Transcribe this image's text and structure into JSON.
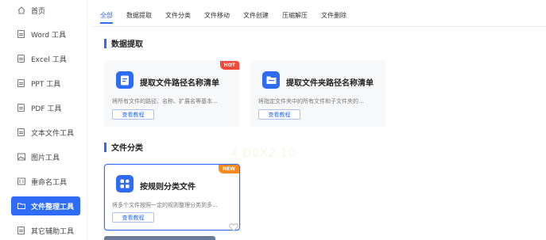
{
  "sidebar": {
    "items": [
      {
        "label": "首页",
        "icon": "home-icon"
      },
      {
        "label": "Word 工具",
        "icon": "document-icon"
      },
      {
        "label": "Excel 工具",
        "icon": "document-icon"
      },
      {
        "label": "PPT 工具",
        "icon": "document-icon"
      },
      {
        "label": "PDF 工具",
        "icon": "document-icon"
      },
      {
        "label": "文本文件工具",
        "icon": "document-icon"
      },
      {
        "label": "图片工具",
        "icon": "image-icon"
      },
      {
        "label": "重命名工具",
        "icon": "rename-icon"
      },
      {
        "label": "文件整理工具",
        "icon": "folder-icon"
      },
      {
        "label": "其它辅助工具",
        "icon": "tools-icon"
      }
    ],
    "active_index": 8
  },
  "tabs": [
    "全部",
    "数据提取",
    "文件分类",
    "文件移动",
    "文件创建",
    "压缩解压",
    "文件删除"
  ],
  "sections": {
    "extract": {
      "title": "数据提取",
      "cards": [
        {
          "title": "提取文件路径名称清单",
          "desc": "将所有文件的路径、名称、扩展名等基本...",
          "button": "查看教程",
          "badge": "HOT"
        },
        {
          "title": "提取文件夹路径名称清单",
          "desc": "将指定文件夹中的所有文件和子文件夹的...",
          "button": "查看教程"
        }
      ]
    },
    "classify": {
      "title": "文件分类",
      "cards": [
        {
          "title": "按规则分类文件",
          "desc": "将多个文件按照一定的规则整理分类到多...",
          "button": "查看教程",
          "badge": "NEW"
        }
      ]
    }
  },
  "watermark": "4 D0X2 10",
  "colors": {
    "accent": "#2f6cf6",
    "hot": "#f24a3a",
    "new": "#ff8a1c"
  }
}
